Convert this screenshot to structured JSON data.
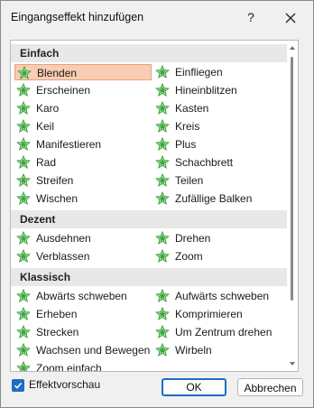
{
  "dialog": {
    "title": "Eingangseffekt hinzufügen",
    "help_label": "?"
  },
  "groups": [
    {
      "name": "Einfach",
      "left": [
        "Blenden",
        "Erscheinen",
        "Karo",
        "Keil",
        "Manifestieren",
        "Rad",
        "Streifen",
        "Wischen"
      ],
      "right": [
        "Einfliegen",
        "Hineinblitzen",
        "Kasten",
        "Kreis",
        "Plus",
        "Schachbrett",
        "Teilen",
        "Zufällige Balken"
      ]
    },
    {
      "name": "Dezent",
      "left": [
        "Ausdehnen",
        "Verblassen"
      ],
      "right": [
        "Drehen",
        "Zoom"
      ]
    },
    {
      "name": "Klassisch",
      "left": [
        "Abwärts schweben",
        "Erheben",
        "Strecken",
        "Wachsen und Bewegen",
        "Zoom einfach"
      ],
      "right": [
        "Aufwärts schweben",
        "Komprimieren",
        "Um Zentrum drehen",
        "Wirbeln"
      ]
    }
  ],
  "selected_effect": "Blenden",
  "footer": {
    "preview_label": "Effektvorschau",
    "preview_checked": true,
    "ok_label": "OK",
    "cancel_label": "Abbrechen"
  },
  "colors": {
    "icon_green": "#3aa53a",
    "selection_bg": "#f9cdb4",
    "accent": "#1b6ec2"
  }
}
